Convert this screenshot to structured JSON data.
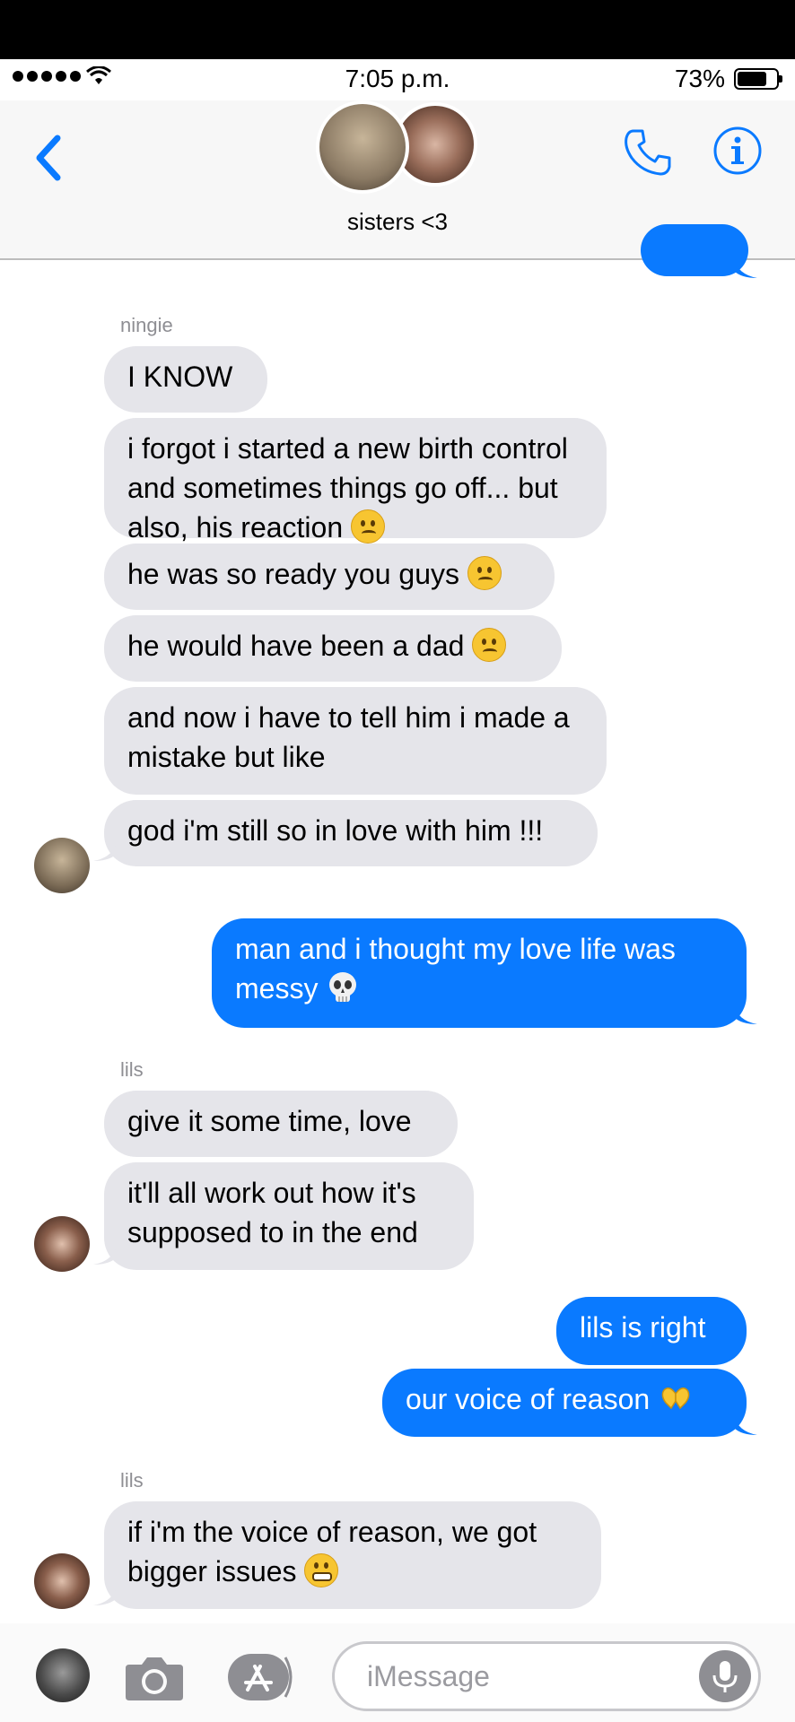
{
  "status_bar": {
    "time": "7:05 p.m.",
    "battery": "73%"
  },
  "nav": {
    "title": "sisters <3"
  },
  "messages": {
    "sender_ningie": "ningie",
    "m1": "I KNOW",
    "m2": "i forgot i started a new birth control and sometimes things go off... but also, his reaction",
    "m3": "he was so ready you guys",
    "m4": "he would have been a dad",
    "m5": "and now i have to tell him i made a mistake but like",
    "m6": "god i'm still so in love with him !!!",
    "m7": "man and i thought my love life was messy",
    "sender_lils_1": "lils",
    "m8": "give it some time, love",
    "m9": "it'll all work out how it's supposed to in the end",
    "m10": "lils is right",
    "m11": "our voice of reason",
    "sender_lils_2": "lils",
    "m12": "if i'm the voice of reason, we got bigger issues"
  },
  "input": {
    "placeholder": "iMessage"
  },
  "icons": [
    "back-chevron-icon",
    "phone-icon",
    "info-icon",
    "camera-icon",
    "app-store-icon",
    "microphone-icon"
  ],
  "colors": {
    "accent": "#0a7aff",
    "incoming_bubble": "#e5e5ea"
  }
}
